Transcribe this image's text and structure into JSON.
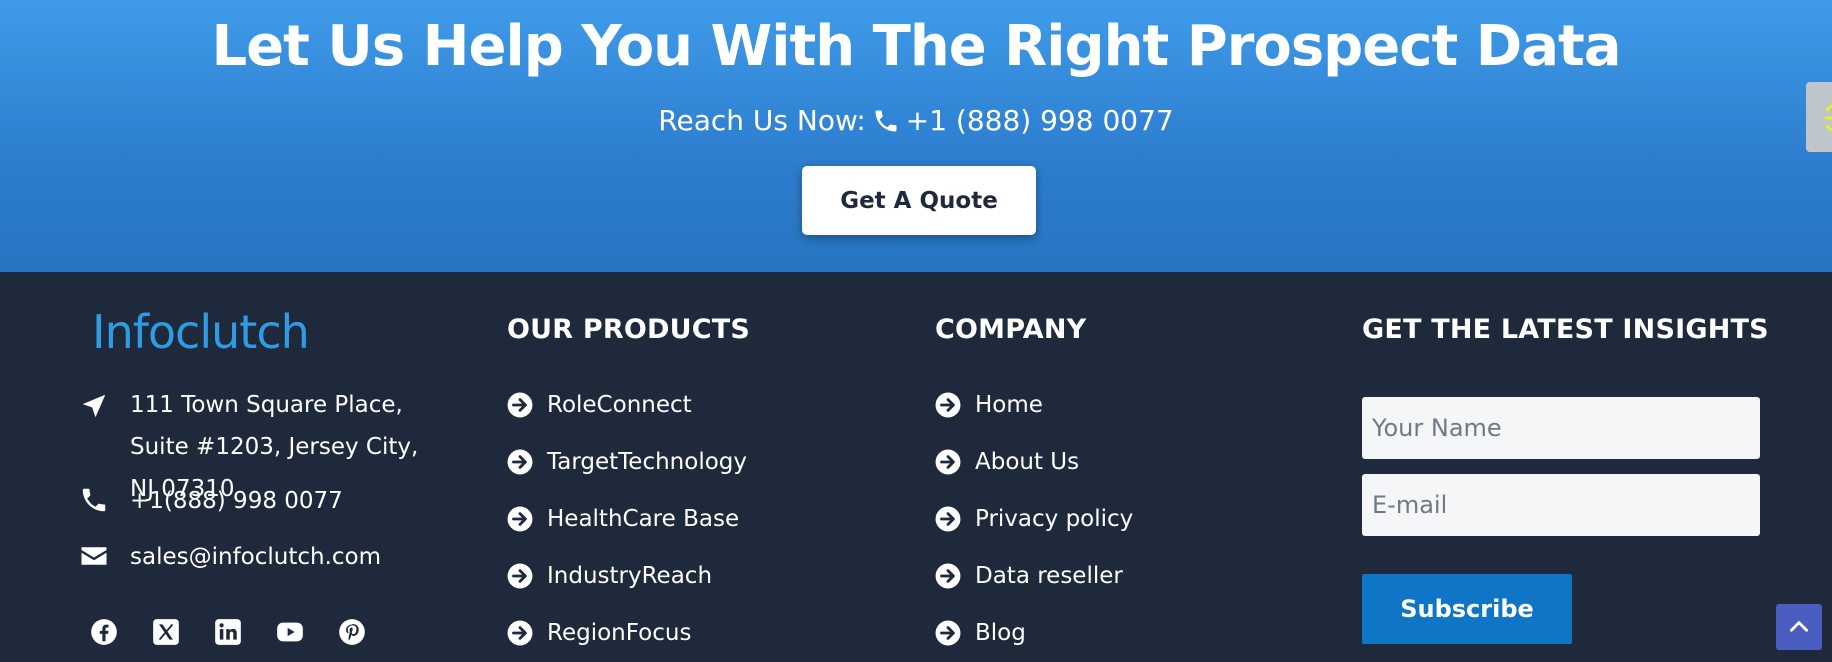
{
  "hero": {
    "title": "Let Us Help You With The Right Prospect Data",
    "reach_label": "Reach Us Now:",
    "reach_phone": "+1 (888) 998 0077",
    "quote_button": "Get A Quote"
  },
  "footer": {
    "logo": "Infoclutch",
    "address": "111 Town Square Place, Suite #1203, Jersey City, NJ 07310",
    "phone": "+1(888) 998 0077",
    "email": "sales@infoclutch.com",
    "social": [
      "facebook-icon",
      "x-icon",
      "linkedin-icon",
      "youtube-icon",
      "pinterest-icon"
    ],
    "products": {
      "title": "OUR PRODUCTS",
      "items": [
        "RoleConnect",
        "TargetTechnology",
        "HealthCare Base",
        "IndustryReach",
        "RegionFocus"
      ]
    },
    "company": {
      "title": "COMPANY",
      "items": [
        "Home",
        "About Us",
        "Privacy policy",
        "Data reseller",
        "Blog"
      ]
    },
    "newsletter": {
      "title": "GET THE LATEST INSIGHTS",
      "name_placeholder": "Your Name",
      "email_placeholder": "E-mail",
      "subscribe_button": "Subscribe"
    }
  },
  "colors": {
    "hero_top": "#3f9be9",
    "hero_bottom": "#2774c2",
    "footer_bg": "#1f293c",
    "logo": "#2f9be3",
    "subscribe": "#0f76c7",
    "scroll_top": "#4a5ec2"
  }
}
